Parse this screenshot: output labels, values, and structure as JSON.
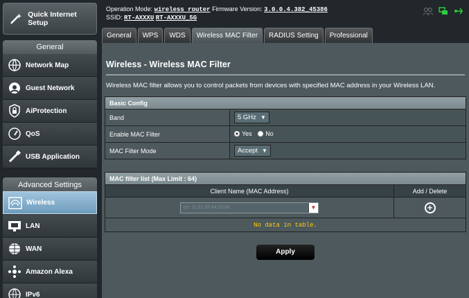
{
  "sidebar": {
    "quick_setup": "Quick Internet Setup",
    "general_header": "General",
    "general_items": [
      {
        "label": "Network Map",
        "icon": "network-map-icon"
      },
      {
        "label": "Guest Network",
        "icon": "guest-network-icon"
      },
      {
        "label": "AiProtection",
        "icon": "lock-icon"
      },
      {
        "label": "QoS",
        "icon": "gauge-icon"
      },
      {
        "label": "USB Application",
        "icon": "usb-icon"
      }
    ],
    "advanced_header": "Advanced Settings",
    "advanced_items": [
      {
        "label": "Wireless",
        "icon": "wifi-icon",
        "active": true
      },
      {
        "label": "LAN",
        "icon": "lan-icon"
      },
      {
        "label": "WAN",
        "icon": "globe-icon"
      },
      {
        "label": "Amazon Alexa",
        "icon": "alexa-icon"
      },
      {
        "label": "IPv6",
        "icon": "ipv6-icon"
      }
    ]
  },
  "topbar": {
    "mode_label": "Operation Mode:",
    "mode_value": "wireless router",
    "fw_label": "Firmware Version:",
    "fw_value": "3.0.0.4.382_45386",
    "ssid_label": "SSID:",
    "ssid_1": "RT-AXXXU",
    "ssid_2": "RT-AXXXU_5G"
  },
  "tabs": [
    "General",
    "WPS",
    "WDS",
    "Wireless MAC Filter",
    "RADIUS Setting",
    "Professional"
  ],
  "active_tab": "Wireless MAC Filter",
  "page": {
    "title": "Wireless - Wireless MAC Filter",
    "description": "Wireless MAC filter allows you to control packets from devices with specified MAC address in your Wireless LAN."
  },
  "basic_config": {
    "header": "Basic Config",
    "band_label": "Band",
    "band_value": "5 GHz",
    "enable_label": "Enable MAC Filter",
    "yes_label": "Yes",
    "no_label": "No",
    "enable_value": "Yes",
    "mode_label": "MAC Filter Mode",
    "mode_value": "Accept"
  },
  "mac_list": {
    "header": "MAC filter list (Max Limit : 64)",
    "col_client": "Client Name (MAC Address)",
    "col_action": "Add / Delete",
    "input_placeholder": "ex: 11:22:33:44:55:66",
    "empty_text": "No data in table."
  },
  "apply_label": "Apply",
  "colors": {
    "panel": "#4d595d",
    "header": "#7a898e",
    "active_nav": "#7fa8c6",
    "empty_text": "#ffcc00"
  }
}
